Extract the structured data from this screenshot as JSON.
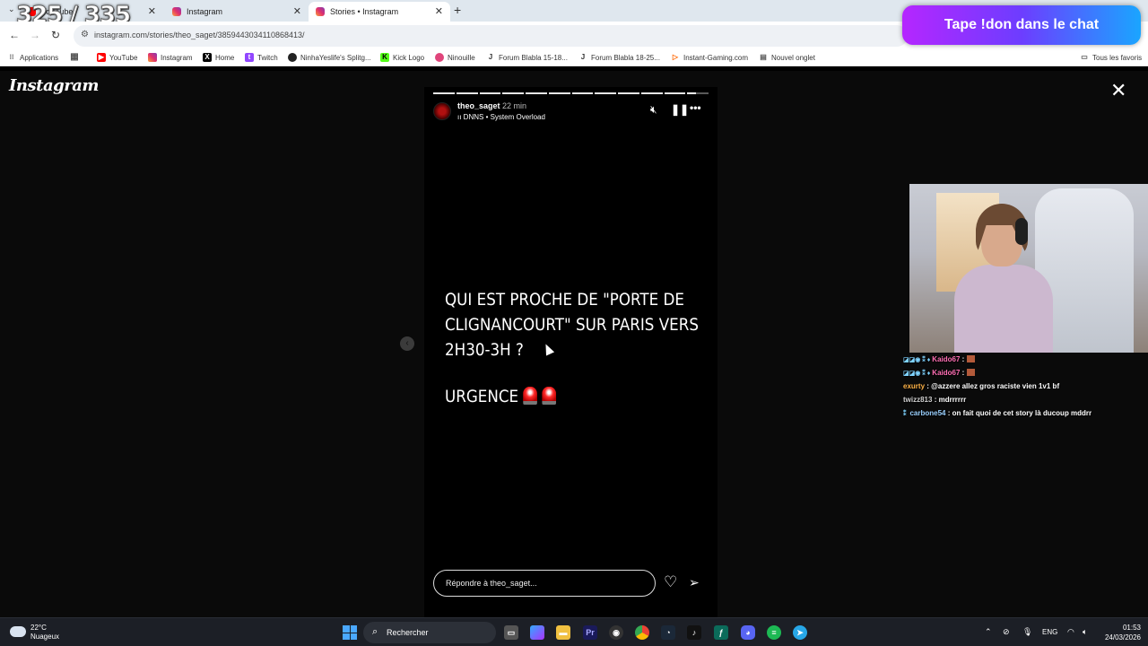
{
  "overlay": {
    "counter": "325 / 335",
    "promo": "Tape !don dans le chat"
  },
  "browser": {
    "tabs": [
      {
        "title": "YouTube",
        "favicon": "youtube-icon",
        "active": false
      },
      {
        "title": "Instagram",
        "favicon": "instagram-icon",
        "active": false
      },
      {
        "title": "Stories • Instagram",
        "favicon": "instagram-icon",
        "active": true
      }
    ],
    "url": "instagram.com/stories/theo_saget/3859443034110868413/",
    "bookmarks": [
      {
        "label": "Applications",
        "icon": "apps-grid-icon"
      },
      {
        "label": "YouTube",
        "icon": "youtube-icon"
      },
      {
        "label": "Instagram",
        "icon": "instagram-icon"
      },
      {
        "label": "Home",
        "icon": "x-icon"
      },
      {
        "label": "Twitch",
        "icon": "twitch-icon"
      },
      {
        "label": "NinhaYeslife's Splitg...",
        "icon": "circle-icon"
      },
      {
        "label": "Kick Logo",
        "icon": "kick-icon"
      },
      {
        "label": "Ninouille",
        "icon": "circle-icon"
      },
      {
        "label": "Forum Blabla 15-18...",
        "icon": "jvc-icon"
      },
      {
        "label": "Forum Blabla 18-25...",
        "icon": "jvc-icon"
      },
      {
        "label": "Instant-Gaming.com",
        "icon": "ig-store-icon"
      },
      {
        "label": "Nouvel onglet",
        "icon": "page-icon"
      }
    ],
    "all_bookmarks": "Tous les favoris"
  },
  "instagram": {
    "logo": "Instagram",
    "story": {
      "username": "theo_saget",
      "time": "22 min",
      "music": "DNNS • System Overload",
      "segments_total": 12,
      "current_segment": 12,
      "text_lines": [
        "QUI EST PROCHE DE \"PORTE DE",
        "CLIGNANCOURT\" SUR PARIS VERS",
        "2H30-3H ?"
      ],
      "urgence": "URGENCE",
      "reply_placeholder": "Répondre à theo_saget..."
    }
  },
  "chat": [
    {
      "user": "Kaido67",
      "user_color": "#ff6fb4",
      "message": ""
    },
    {
      "user": "Kaido67",
      "user_color": "#ff6fb4",
      "message": ""
    },
    {
      "user": "exurty",
      "user_color": "#ffb347",
      "message": "@azzere allez gros raciste vien 1v1 bf"
    },
    {
      "user": "twizz813",
      "user_color": "#cfcfcf",
      "message": "mdrrrrrr"
    },
    {
      "user": "carbone54",
      "user_color": "#9ad0ff",
      "message": "on fait quoi de cet story là ducoup mddrr"
    }
  ],
  "taskbar": {
    "weather_temp": "22°C",
    "weather_desc": "Nuageux",
    "search": "Rechercher",
    "lang": "ENG",
    "time": "01:53",
    "date": "24/03/2026"
  }
}
